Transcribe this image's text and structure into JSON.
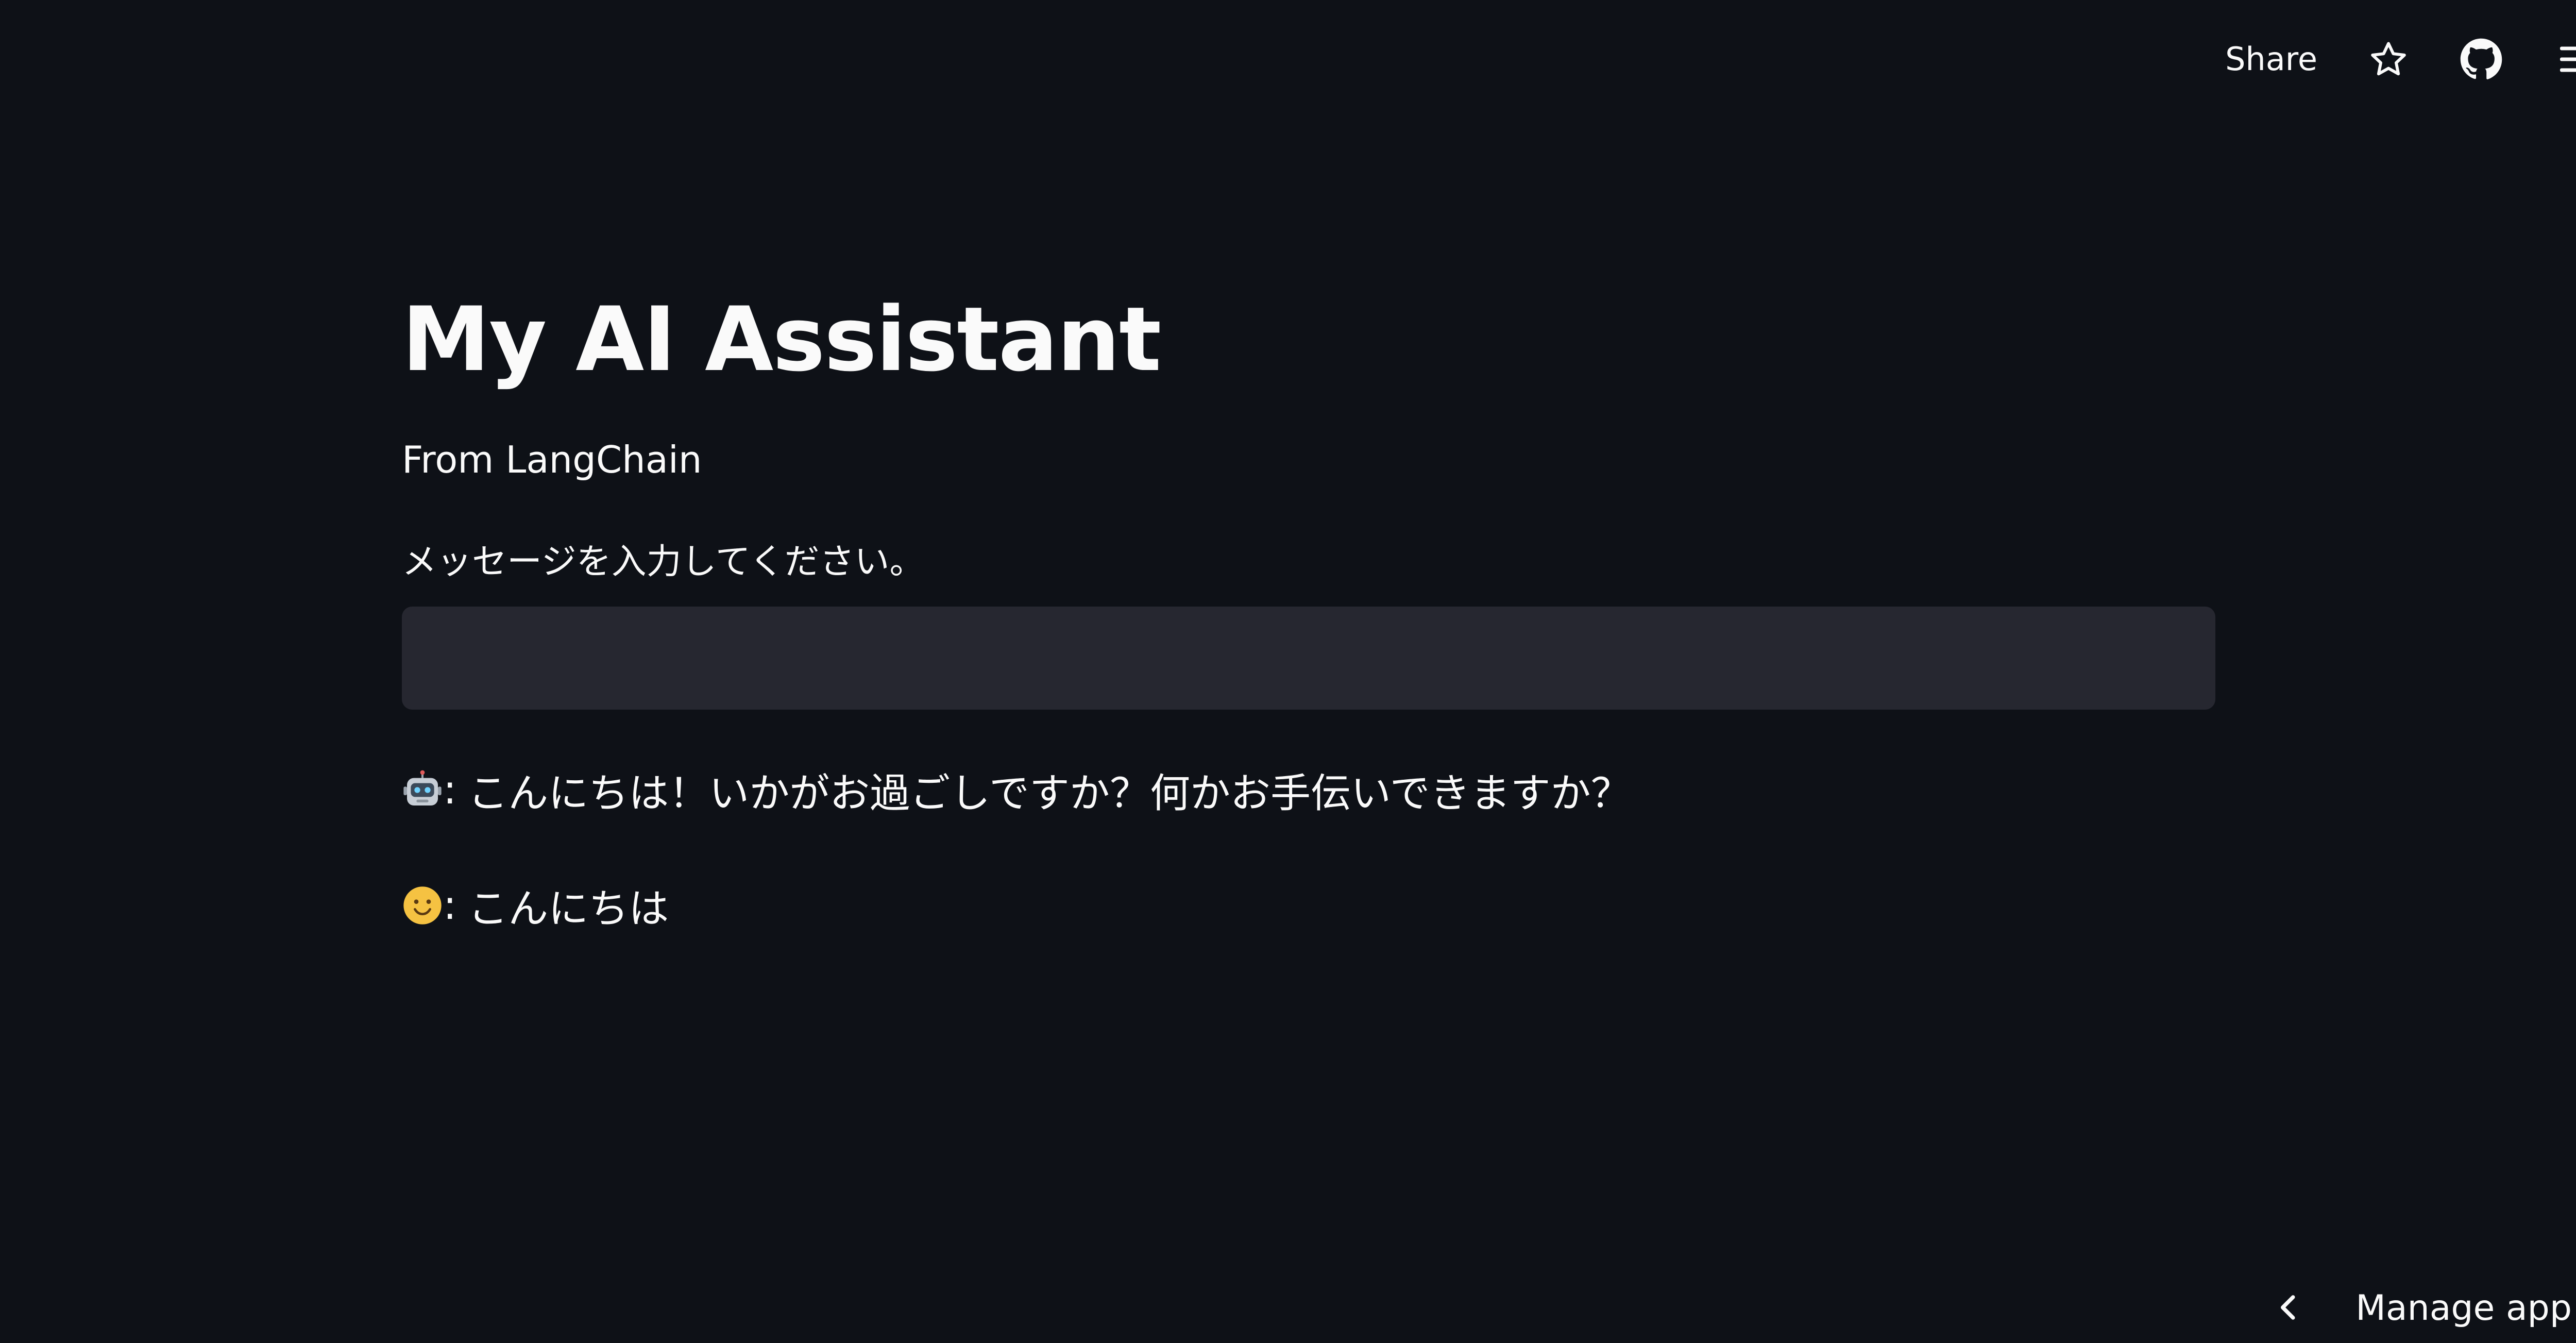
{
  "header": {
    "share_label": "Share",
    "icons": [
      "star-icon",
      "github-icon",
      "hamburger-menu-icon"
    ]
  },
  "main": {
    "title": "My AI Assistant",
    "subtitle": "From LangChain",
    "input_label": "メッセージを入力してください。",
    "input_value": "",
    "input_placeholder": ""
  },
  "messages": [
    {
      "role": "ai",
      "avatar_icon": "robot-icon",
      "separator": ":",
      "text": "こんにちは！いかがお過ごしですか？何かお手伝いできますか？"
    },
    {
      "role": "user",
      "avatar_icon": "smiley-face-icon",
      "separator": ":",
      "text": "こんにちは"
    }
  ],
  "footer": {
    "manage_app_label": "Manage app",
    "icon": "chevron-left-icon"
  },
  "colors": {
    "background": "#0e1117",
    "input_background": "#262730",
    "text": "#fafafa"
  }
}
